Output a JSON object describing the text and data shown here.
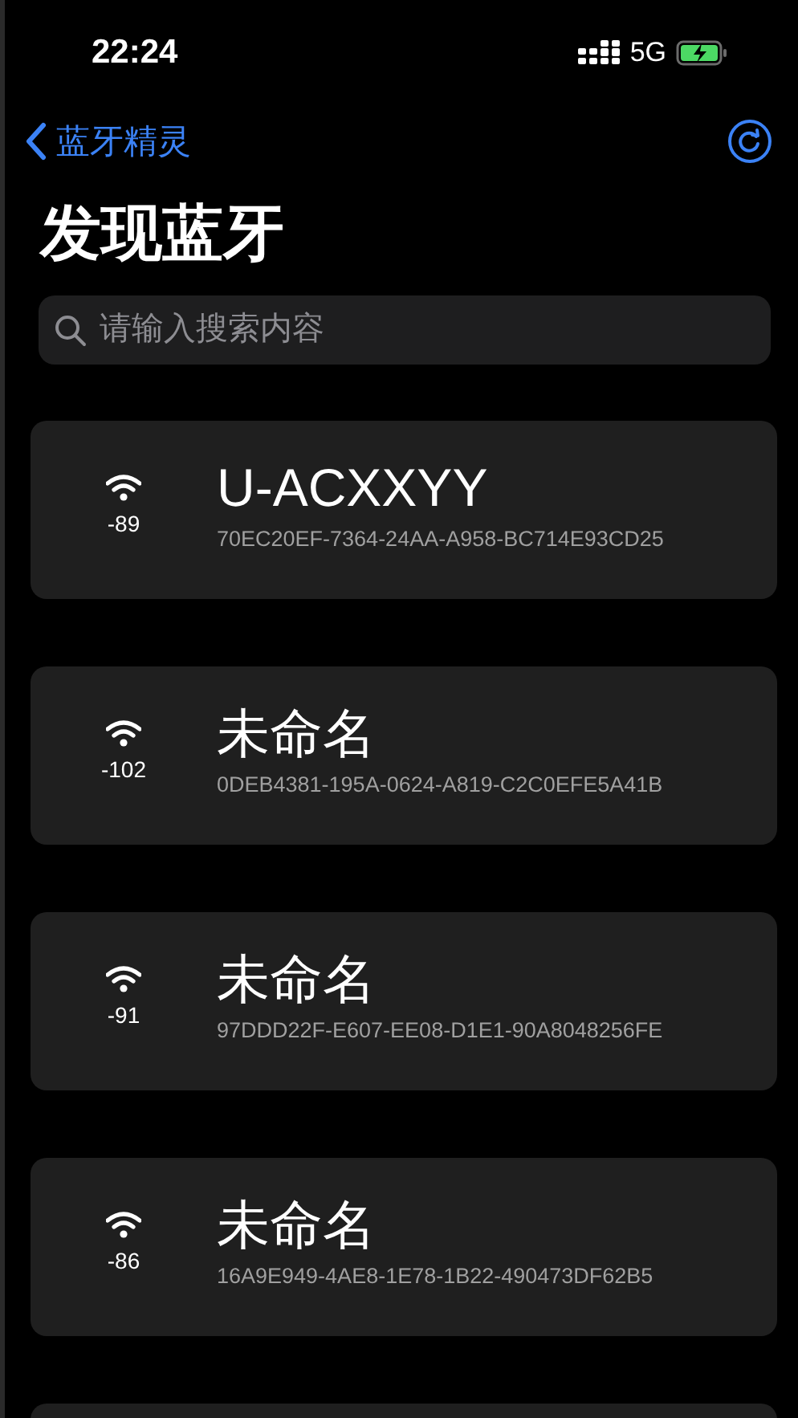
{
  "status_bar": {
    "time": "22:24",
    "network": "5G"
  },
  "nav": {
    "back_label": "蓝牙精灵"
  },
  "title": "发现蓝牙",
  "search": {
    "placeholder": "请输入搜索内容"
  },
  "devices": [
    {
      "name": "U-ACXXYY",
      "rssi": "-89",
      "uuid": "70EC20EF-7364-24AA-A958-BC714E93CD25"
    },
    {
      "name": "未命名",
      "rssi": "-102",
      "uuid": "0DEB4381-195A-0624-A819-C2C0EFE5A41B"
    },
    {
      "name": "未命名",
      "rssi": "-91",
      "uuid": "97DDD22F-E607-EE08-D1E1-90A8048256FE"
    },
    {
      "name": "未命名",
      "rssi": "-86",
      "uuid": "16A9E949-4AE8-1E78-1B22-490473DF62B5"
    }
  ]
}
